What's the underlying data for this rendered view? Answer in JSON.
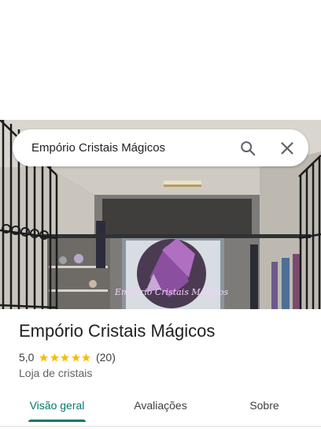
{
  "search": {
    "query": "Empório Cristais Mágicos",
    "search_icon": "search-icon",
    "close_icon": "close-icon"
  },
  "place": {
    "photo_sign_text": "Empório Cristais Mágicos",
    "name": "Empório Cristais Mágicos",
    "rating": "5,0",
    "stars_filled": 5,
    "stars_total": 5,
    "review_count": "(20)",
    "category": "Loja de cristais"
  },
  "tabs": [
    {
      "label": "Visão geral",
      "active": true
    },
    {
      "label": "Avaliações",
      "active": false
    },
    {
      "label": "Sobre",
      "active": false
    }
  ],
  "colors": {
    "accent": "#00796b",
    "star": "#fbbc04"
  }
}
